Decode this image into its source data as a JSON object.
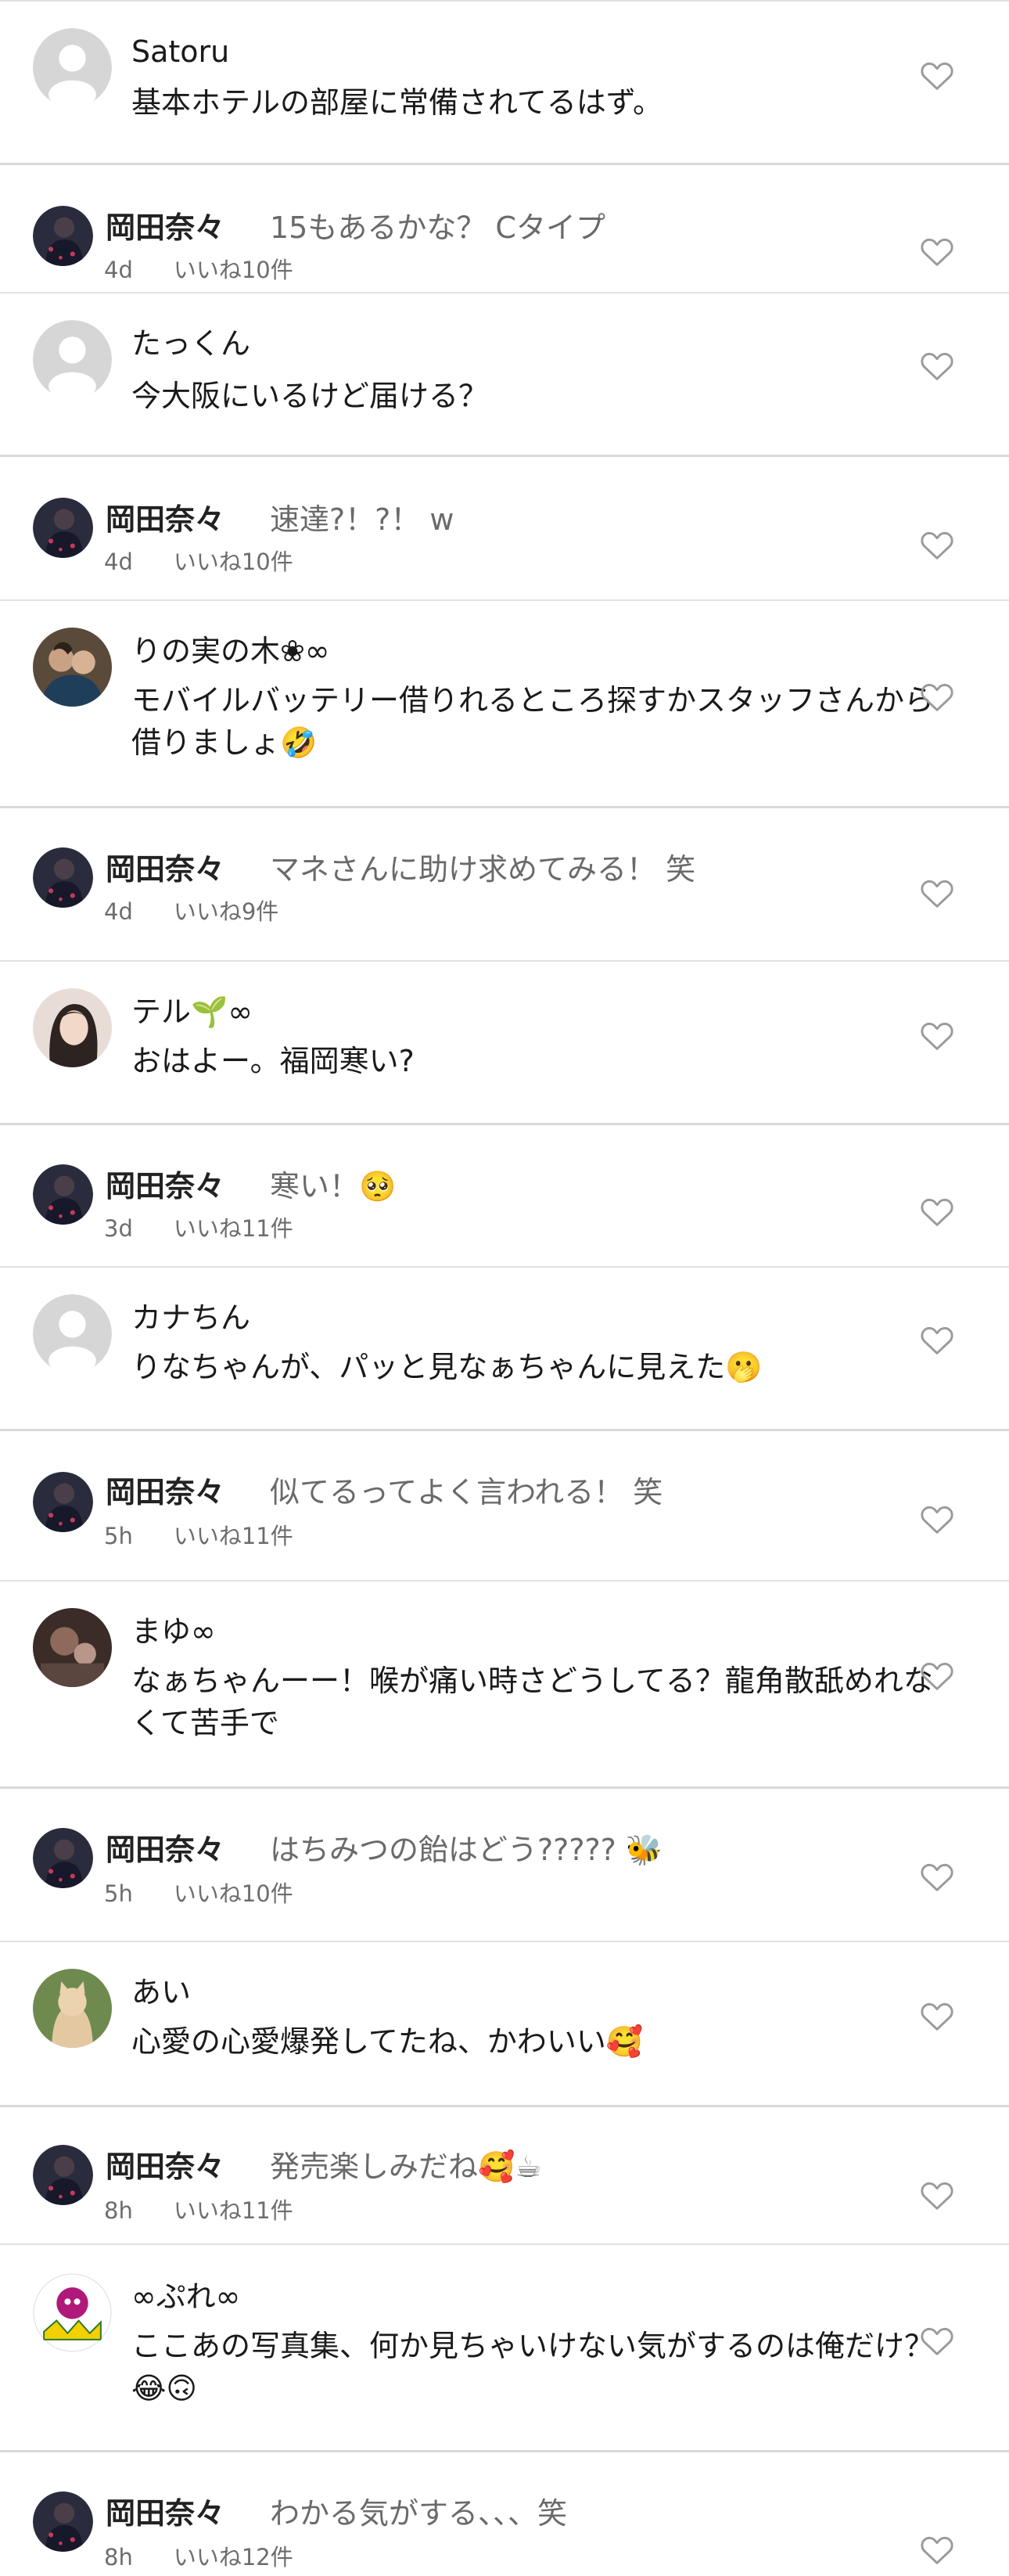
{
  "comments": [
    {
      "type": "comment",
      "avatar": "default",
      "name": "Satoru",
      "text": "基本ホテルの部屋に常備されてるはず。"
    },
    {
      "type": "reply",
      "name": "岡田奈々",
      "text": "15もあるかな？ Cタイプ",
      "time": "4d",
      "likes": "いいね10件"
    },
    {
      "type": "comment",
      "avatar": "default",
      "name": "たっくん",
      "text": "今大阪にいるけど届ける？"
    },
    {
      "type": "reply",
      "name": "岡田奈々",
      "text": "速達?！?！ w",
      "time": "4d",
      "likes": "いいね10件"
    },
    {
      "type": "comment",
      "avatar": "photo-couple",
      "name": "りの実の木❀∞",
      "text": "モバイルバッテリー借りれるところ探すかスタッフさんから借りましょ🤣"
    },
    {
      "type": "reply",
      "name": "岡田奈々",
      "text": "マネさんに助け求めてみる！ 笑",
      "time": "4d",
      "likes": "いいね9件"
    },
    {
      "type": "comment",
      "avatar": "photo-woman",
      "name": "テル🌱∞",
      "text": "おはよー。福岡寒い?"
    },
    {
      "type": "reply",
      "name": "岡田奈々",
      "text": "寒い！🥺",
      "time": "3d",
      "likes": "いいね11件"
    },
    {
      "type": "comment",
      "avatar": "default",
      "name": "カナちん",
      "text": "りなちゃんが、パッと見なぁちゃんに見えた🫢"
    },
    {
      "type": "reply",
      "name": "岡田奈々",
      "text": "似てるってよく言われる！ 笑",
      "time": "5h",
      "likes": "いいね11件"
    },
    {
      "type": "comment",
      "avatar": "photo-dark",
      "name": "まゆ∞",
      "text": "なぁちゃんーー！喉が痛い時さどうしてる？龍角散舐めれなくて苦手で"
    },
    {
      "type": "reply",
      "name": "岡田奈々",
      "text": "はちみつの飴はどう?????  🐝",
      "time": "5h",
      "likes": "いいね10件"
    },
    {
      "type": "comment",
      "avatar": "photo-cat",
      "name": "あい",
      "text": "心愛の心愛爆発してたね、かわいい🥰"
    },
    {
      "type": "reply",
      "name": "岡田奈々",
      "text": "発売楽しみだね🥰☕",
      "time": "8h",
      "likes": "いいね11件"
    },
    {
      "type": "comment",
      "avatar": "illustration",
      "name": "∞ぷれ∞",
      "text": "ここあの写真集、何か見ちゃいけない気がするのは俺だけ？ 😂🙃"
    },
    {
      "type": "reply",
      "name": "岡田奈々",
      "text": "わかる気がする、、、笑",
      "time": "8h",
      "likes": "いいね12件"
    }
  ],
  "icons": {
    "like": "heart-outline-icon",
    "default_avatar": "person-silhouette-icon"
  },
  "colors": {
    "separator": "#d9d9d9",
    "secondary_text": "#6d6d6d",
    "heart": "#9a9a9a",
    "default_avatar_bg": "#d6d6d6"
  }
}
